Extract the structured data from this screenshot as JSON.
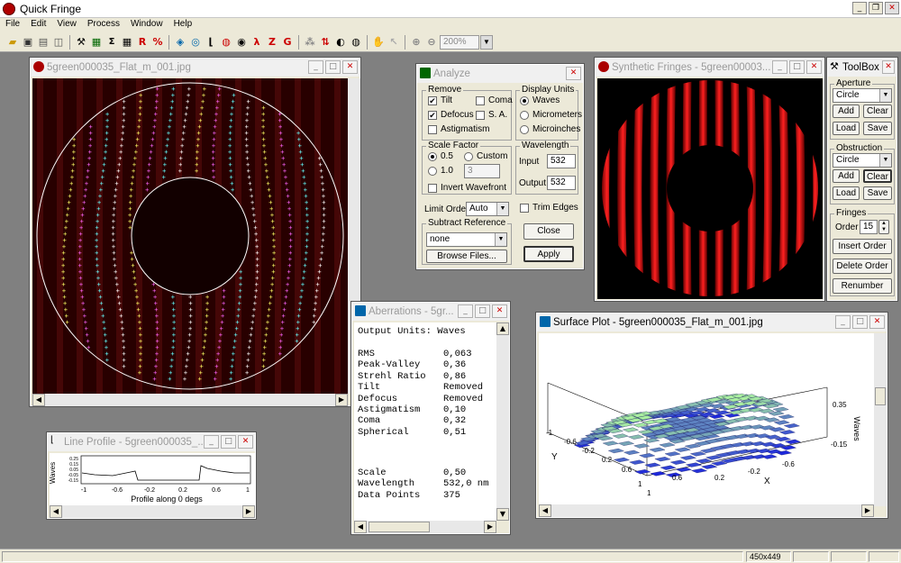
{
  "app": {
    "title": "Quick Fringe"
  },
  "menu": [
    "File",
    "Edit",
    "View",
    "Process",
    "Window",
    "Help"
  ],
  "toolbar": {
    "zoom": "200%"
  },
  "fringe_window": {
    "title": "5green000035_Flat_m_001.jpg"
  },
  "analyze": {
    "title": "Analyze",
    "remove_label": "Remove",
    "tilt": "Tilt",
    "coma": "Coma",
    "defocus": "Defocus",
    "sa": "S. A.",
    "astigmatism": "Astigmatism",
    "display_units_label": "Display Units",
    "waves": "Waves",
    "micrometers": "Micrometers",
    "microinches": "Microinches",
    "scale_factor_label": "Scale Factor",
    "sf_05": "0.5",
    "custom": "Custom",
    "sf_10": "1.0",
    "custom_value": "3",
    "invert_wavefront": "Invert Wavefront",
    "wavelength_label": "Wavelength",
    "input_label": "Input",
    "input_value": "532",
    "output_label": "Output",
    "output_value": "532",
    "limit_order_label": "Limit Order",
    "limit_order_value": "Auto",
    "trim_edges": "Trim Edges",
    "subtract_reference_label": "Subtract Reference",
    "subtract_value": "none",
    "browse": "Browse Files...",
    "close": "Close",
    "apply": "Apply"
  },
  "synthetic": {
    "title": "Synthetic Fringes - 5green00003..."
  },
  "toolbox": {
    "title": "ToolBox",
    "aperture_label": "Aperture",
    "aperture_value": "Circle",
    "add": "Add",
    "clear": "Clear",
    "load": "Load",
    "save": "Save",
    "obstruction_label": "Obstruction",
    "obstruction_value": "Circle",
    "fringes_label": "Fringes",
    "order_label": "Order",
    "order_value": "15",
    "insert_order": "Insert Order",
    "delete_order": "Delete Order",
    "renumber": "Renumber"
  },
  "aberrations": {
    "title": "Aberrations - 5gr...",
    "header": "Output Units: Waves",
    "rows": [
      {
        "name": "RMS",
        "value": "0,063"
      },
      {
        "name": "Peak-Valley",
        "value": "0,36"
      },
      {
        "name": "Strehl Ratio",
        "value": "0,86"
      },
      {
        "name": "Tilt",
        "value": "Removed"
      },
      {
        "name": "Defocus",
        "value": "Removed"
      },
      {
        "name": "Astigmatism",
        "value": "0,10"
      },
      {
        "name": "Coma",
        "value": "0,32"
      },
      {
        "name": "Spherical",
        "value": "0,51"
      }
    ],
    "rows2": [
      {
        "name": "Scale",
        "value": "0,50"
      },
      {
        "name": "Wavelength",
        "value": "532,0 nm"
      },
      {
        "name": "Data Points",
        "value": "375"
      }
    ]
  },
  "line_profile": {
    "title": "Line Profile - 5green000035_...",
    "ylabel": "Waves",
    "yticks": [
      "0.25",
      "0.15",
      "0.05",
      "-0.05",
      "-0.15"
    ],
    "xticks": [
      "-1",
      "-0.6",
      "-0.2",
      "0.2",
      "0.6",
      "1"
    ],
    "xlabel": "Profile along 0 degs"
  },
  "surface": {
    "title": "Surface Plot - 5green000035_Flat_m_001.jpg",
    "zticks": [
      "0.35",
      "-0.15"
    ],
    "zlabel": "Waves",
    "ylabel": "Y",
    "xlabel": "X",
    "yticks": [
      "-1",
      "-0.6",
      "-0.2",
      "0.2",
      "0.6",
      "1"
    ],
    "xticks": [
      "1",
      "0.6",
      "0.2",
      "-0.2",
      "-0.6"
    ]
  },
  "status": {
    "size": "450x449"
  }
}
